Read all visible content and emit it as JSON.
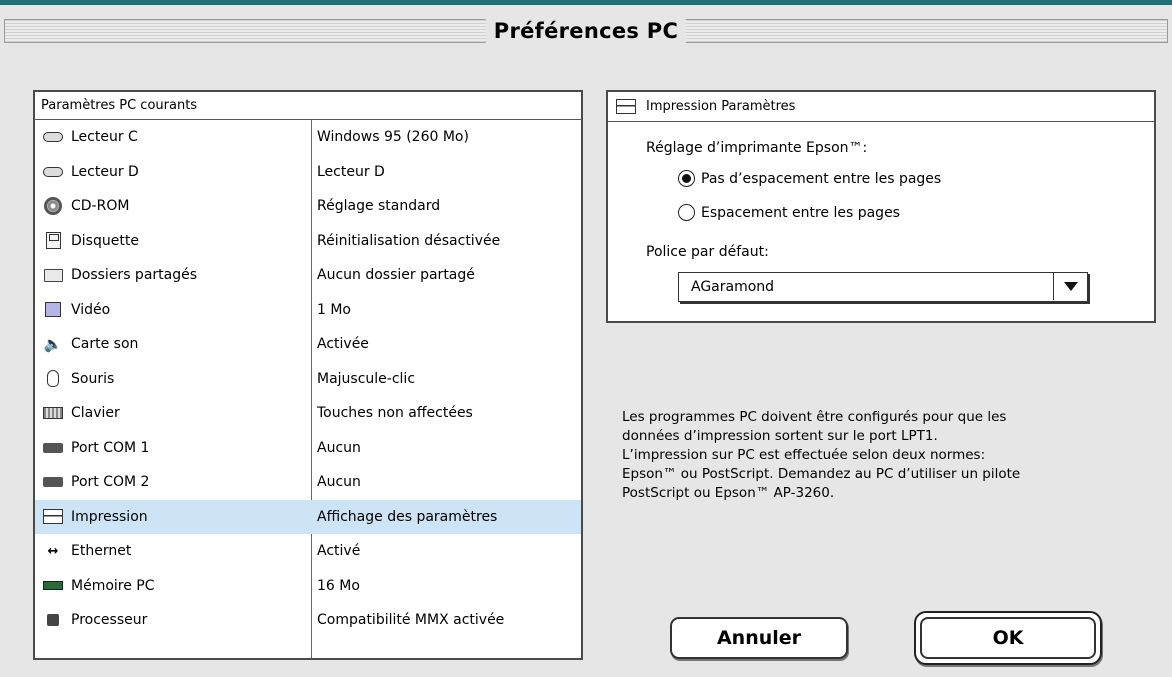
{
  "window": {
    "title": "Préférences PC"
  },
  "settings": {
    "header": "Paramètres PC courants",
    "rows": [
      {
        "icon": "hard-drive-icon",
        "name": "Lecteur C",
        "value": "Windows 95 (260 Mo)"
      },
      {
        "icon": "hard-drive-icon",
        "name": "Lecteur D",
        "value": "Lecteur D"
      },
      {
        "icon": "cd-rom-icon",
        "name": "CD-ROM",
        "value": "Réglage standard"
      },
      {
        "icon": "floppy-icon",
        "name": "Disquette",
        "value": "Réinitialisation désactivée"
      },
      {
        "icon": "folder-icon",
        "name": "Dossiers partagés",
        "value": "Aucun dossier partagé"
      },
      {
        "icon": "video-icon",
        "name": "Vidéo",
        "value": "1 Mo"
      },
      {
        "icon": "speaker-icon",
        "name": "Carte son",
        "value": "Activée"
      },
      {
        "icon": "mouse-icon",
        "name": "Souris",
        "value": "Majuscule-clic"
      },
      {
        "icon": "keyboard-icon",
        "name": "Clavier",
        "value": "Touches non affectées"
      },
      {
        "icon": "com-port-icon",
        "name": "Port COM 1",
        "value": "Aucun"
      },
      {
        "icon": "com-port-icon",
        "name": "Port COM 2",
        "value": "Aucun"
      },
      {
        "icon": "printer-icon",
        "name": "Impression",
        "value": "Affichage des paramètres",
        "selected": true
      },
      {
        "icon": "ethernet-icon",
        "name": "Ethernet",
        "value": "Activé"
      },
      {
        "icon": "memory-icon",
        "name": "Mémoire PC",
        "value": "16 Mo"
      },
      {
        "icon": "processor-icon",
        "name": "Processeur",
        "value": "Compatibilité MMX activée"
      }
    ]
  },
  "print_panel": {
    "header": "Impression Paramètres",
    "printer_setting_label": "Réglage d’imprimante Epson™:",
    "radio_options": [
      {
        "label": "Pas d’espacement entre les pages",
        "checked": true
      },
      {
        "label": "Espacement entre les pages",
        "checked": false
      }
    ],
    "font_label": "Police par défaut:",
    "font_value": "AGaramond"
  },
  "help_text": [
    "Les programmes PC doivent être configurés pour que les",
    "données d’impression sortent sur le port LPT1.",
    "L’impression sur PC est effectuée selon deux normes:",
    "Epson™ ou PostScript. Demandez au PC d’utiliser un pilote",
    "PostScript ou Epson™ AP-3260."
  ],
  "buttons": {
    "cancel": "Annuler",
    "ok": "OK"
  }
}
